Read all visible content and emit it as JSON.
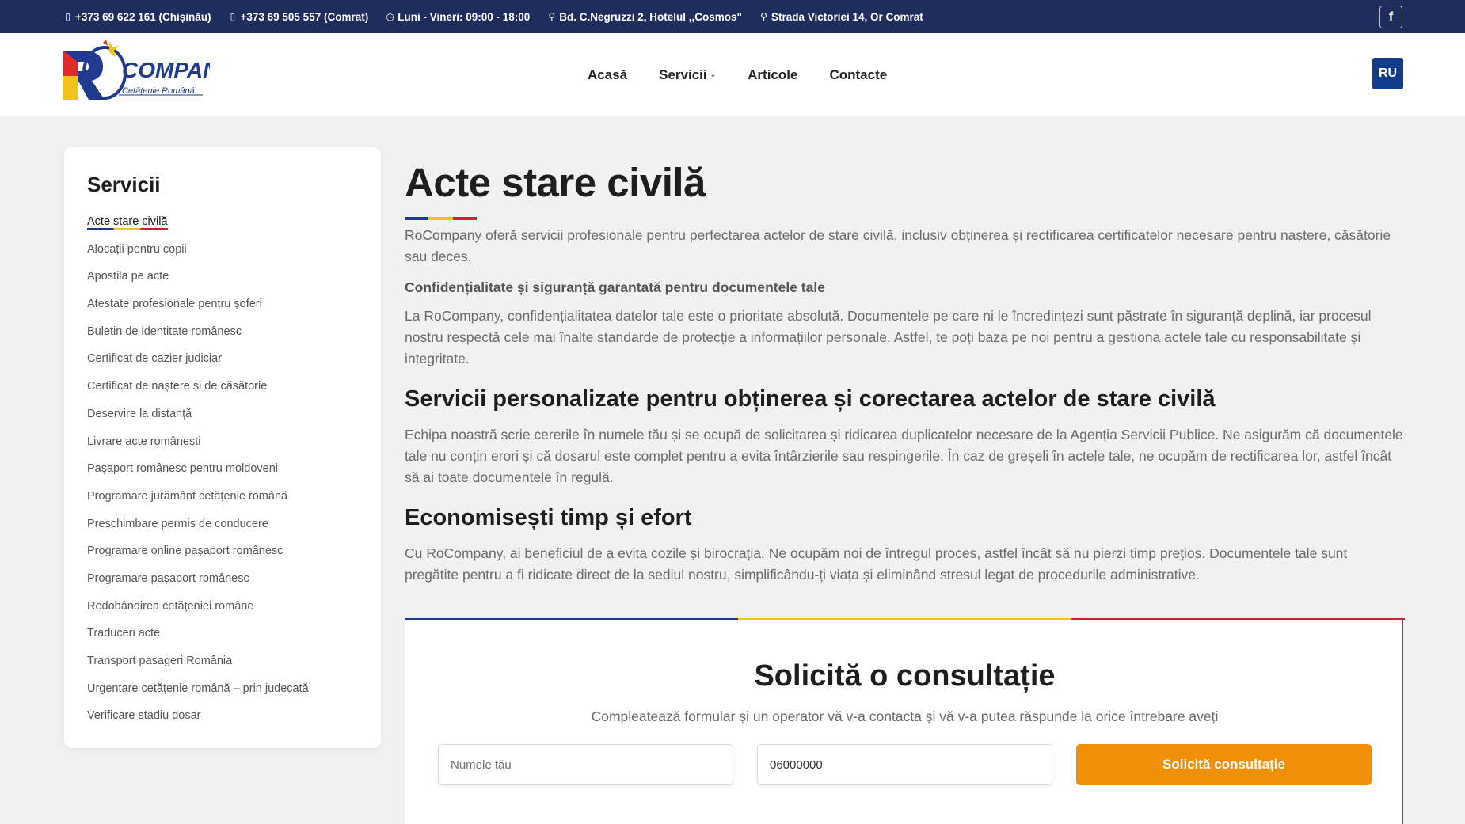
{
  "topbar": {
    "phone1": "+373 69 622 161 (Chișinău)",
    "phone2": "+373 69 505 557 (Comrat)",
    "hours": "Luni - Vineri: 09:00 - 18:00",
    "address1": "Bd. C.Negruzzi 2, Hotelul ,,Cosmos\"",
    "address2": "Strada Victoriei 14, Or Comrat",
    "facebook_icon": "f"
  },
  "logo": {
    "wordmark": "COMPANY",
    "tagline": "Cetățenie Română"
  },
  "nav": {
    "items": [
      "Acasă",
      "Servicii",
      "Articole",
      "Contacte"
    ],
    "lang": "RU"
  },
  "sidebar": {
    "title": "Servicii",
    "items": [
      "Acte stare civilă",
      "Alocații pentru copii",
      "Apostila pe acte",
      "Atestate profesionale pentru șoferi",
      "Buletin de identitate românesc",
      "Certificat de cazier judiciar",
      "Certificat de naștere și de căsătorie",
      "Deservire la distanță",
      "Livrare acte românești",
      "Pașaport românesc pentru moldoveni",
      "Programare jurământ cetățenie română",
      "Preschimbare permis de conducere",
      "Programare online pașaport românesc",
      "Programare pașaport românesc",
      "Redobândirea cetățeniei române",
      "Traduceri acte",
      "Transport pasageri România",
      "Urgentare cetățenie română – prin judecată",
      "Verificare stadiu dosar"
    ]
  },
  "main": {
    "title": "Acte stare civilă",
    "intro": "RoCompany oferă servicii profesionale pentru perfectarea actelor de stare civilă, inclusiv obținerea și rectificarea certificatelor necesare pentru naștere, căsătorie sau deces.",
    "bold_line": "Confidențialitate și siguranță garantată pentru documentele tale",
    "para2": "La RoCompany, confidențialitatea datelor tale este o prioritate absolută. Documentele pe care ni le încredințezi sunt păstrate în siguranță deplină, iar procesul nostru respectă cele mai înalte standarde de protecție a informațiilor personale. Astfel, te poți baza pe noi pentru a gestiona actele tale cu responsabilitate și integritate.",
    "heading2": "Servicii personalizate pentru obținerea și corectarea actelor de stare civilă",
    "para3": "Echipa noastră scrie cererile în numele tău și se ocupă de solicitarea și ridicarea duplicatelor necesare de la Agenția Servicii Publice. Ne asigurăm că documentele tale nu conțin erori și că dosarul este complet pentru a evita întârzierile sau respingerile. În caz de greșeli în actele tale, ne ocupăm de rectificarea lor, astfel încât să ai toate documentele în regulă.",
    "heading3": "Economisești timp și efort",
    "para4": "Cu RoCompany, ai beneficiul de a evita cozile și birocrația. Ne ocupăm noi de întregul proces, astfel încât să nu pierzi timp prețios. Documentele tale sunt pregătite pentru a fi ridicate direct de la sediul nostru, simplificându-ți viața și eliminând stresul legat de procedurile administrative."
  },
  "consult": {
    "title": "Solicită o consultație",
    "subtitle": "Compleatează formular și un operator vă v-a contacta și vă v-a putea răspunde la orice întrebare aveți",
    "name_placeholder": "Numele tău",
    "phone_value": "06000000",
    "submit_label": "Solicită consultație"
  },
  "colors": {
    "blue": "#1f3a8f",
    "yellow": "#f2c318",
    "red": "#cf1f35",
    "accent": "#ef9008",
    "topbar": "#1f2d5c"
  }
}
